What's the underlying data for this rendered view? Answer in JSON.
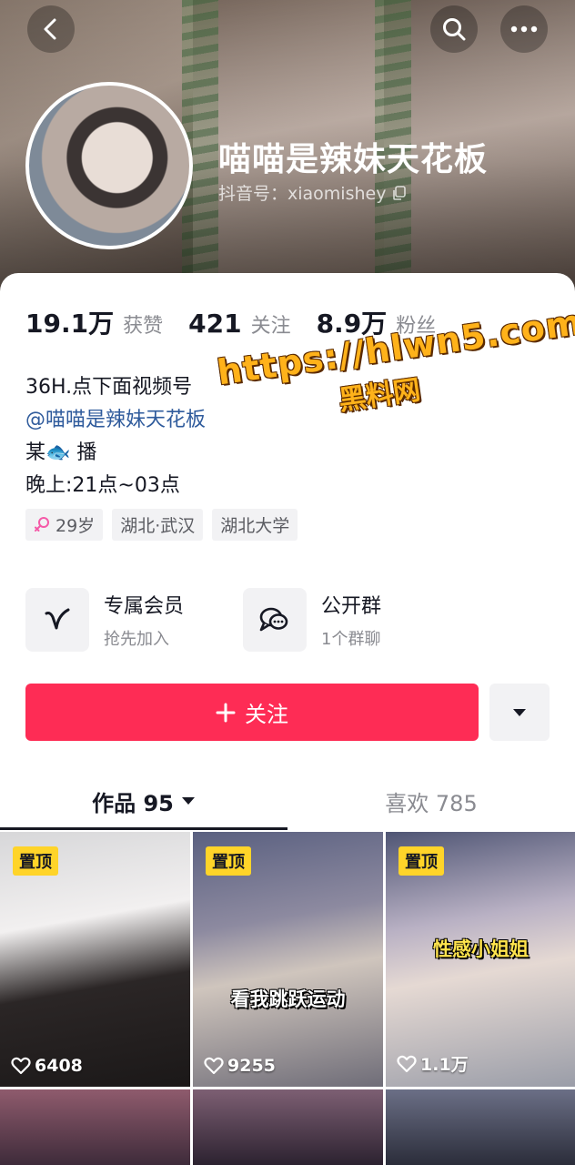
{
  "header": {
    "nickname": "喵喵是辣妹天花板",
    "douyin_id": "抖音号：xiaomishey",
    "back_icon": "chevron-left-icon",
    "search_icon": "search-icon",
    "more_icon": "more-dots-icon"
  },
  "stats": [
    {
      "value": "19.1万",
      "label": "获赞"
    },
    {
      "value": "421",
      "label": "关注"
    },
    {
      "value": "8.9万",
      "label": "粉丝"
    }
  ],
  "bio": {
    "line1": "36H.点下面视频号",
    "mention": "@喵喵是辣妹天花板",
    "line3_prefix": "某",
    "line3_emoji": "🐟",
    "line3_suffix": "播",
    "line4": "晚上:21点~03点"
  },
  "tags": [
    {
      "label": "29岁",
      "icon": "female-icon"
    },
    {
      "label": "湖北·武汉"
    },
    {
      "label": "湖北大学"
    }
  ],
  "services": [
    {
      "title": "专属会员",
      "subtitle": "抢先加入",
      "icon": "v-membership-icon"
    },
    {
      "title": "公开群",
      "subtitle": "1个群聊",
      "icon": "chat-bubbles-icon"
    }
  ],
  "follow_button": {
    "label": "关注",
    "icon": "plus-icon"
  },
  "dropdown_icon": "caret-down-icon",
  "tabs": [
    {
      "label": "作品 95",
      "active": true
    },
    {
      "label": "喜欢 785",
      "active": false
    }
  ],
  "videos": [
    {
      "pinned": "置顶",
      "likes": "6408",
      "caption": ""
    },
    {
      "pinned": "置顶",
      "likes": "9255",
      "caption": "看我跳跃运动"
    },
    {
      "pinned": "置顶",
      "likes": "1.1万",
      "caption": "性感小姐姐"
    }
  ],
  "watermark": {
    "url": "https://hlwn5.com",
    "text": "黑料网"
  },
  "colors": {
    "accent": "#fe2c55",
    "pin": "#ffd429",
    "mention": "#2f5b9c"
  }
}
